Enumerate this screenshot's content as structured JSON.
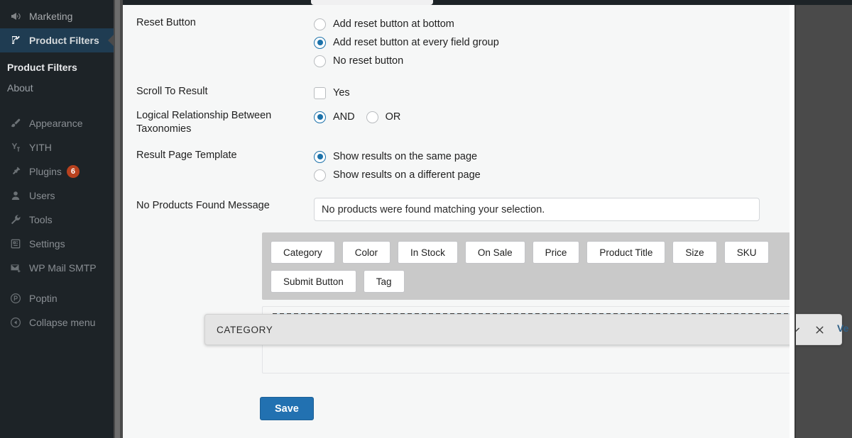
{
  "sidebar": {
    "items": [
      {
        "label": "Marketing",
        "icon": "megaphone-icon",
        "state": "normal"
      },
      {
        "label": "Product Filters",
        "icon": "filter-edit-icon",
        "state": "active"
      }
    ],
    "submenu": [
      {
        "label": "Product Filters",
        "current": true
      },
      {
        "label": "About",
        "current": false
      }
    ],
    "items2": [
      {
        "label": "Appearance",
        "icon": "brush-icon",
        "badge": ""
      },
      {
        "label": "YITH",
        "icon": "yith-icon",
        "badge": ""
      },
      {
        "label": "Plugins",
        "icon": "plug-icon",
        "badge": "6"
      },
      {
        "label": "Users",
        "icon": "user-icon",
        "badge": ""
      },
      {
        "label": "Tools",
        "icon": "wrench-icon",
        "badge": ""
      },
      {
        "label": "Settings",
        "icon": "sliders-icon",
        "badge": ""
      },
      {
        "label": "WP Mail SMTP",
        "icon": "mail-icon",
        "badge": ""
      }
    ],
    "items3": [
      {
        "label": "Poptin",
        "icon": "poptin-icon"
      },
      {
        "label": "Collapse menu",
        "icon": "collapse-arrow-icon"
      }
    ],
    "badge_color": "#b8411e",
    "active_color": "#1f3c52"
  },
  "form": {
    "rows": [
      {
        "label": "Reset Button",
        "type": "radio-group",
        "options": [
          {
            "label": "Add reset button at bottom",
            "selected": false
          },
          {
            "label": "Add reset button at every field group",
            "selected": true
          },
          {
            "label": "No reset button",
            "selected": false
          }
        ]
      },
      {
        "label": "Scroll To Result",
        "type": "checkbox",
        "options": [
          {
            "label": "Yes",
            "checked": false
          }
        ]
      },
      {
        "label": "Logical Relationship Between Taxonomies",
        "type": "radio-inline",
        "options": [
          {
            "label": "AND",
            "selected": true
          },
          {
            "label": "OR",
            "selected": false
          }
        ]
      },
      {
        "label": "Result Page Template",
        "type": "radio-group",
        "options": [
          {
            "label": "Show results on the same page",
            "selected": true
          },
          {
            "label": "Show results on a different page",
            "selected": false
          }
        ]
      },
      {
        "label": "No Products Found Message",
        "type": "text",
        "value": "No products were found matching your selection.",
        "placeholder": ""
      }
    ]
  },
  "palette": {
    "chips": [
      "Category",
      "Color",
      "In Stock",
      "On Sale",
      "Price",
      "Product Title",
      "Size",
      "SKU",
      "Submit Button",
      "Tag"
    ]
  },
  "dropzone": {
    "field_card": {
      "title": "CATEGORY",
      "collapse_icon": "chevron-down-icon",
      "remove_icon": "close-icon"
    }
  },
  "footer": {
    "save_label": "Save",
    "save_color": "#2271b1"
  },
  "offscreen": {
    "partial_text": "Ve"
  }
}
